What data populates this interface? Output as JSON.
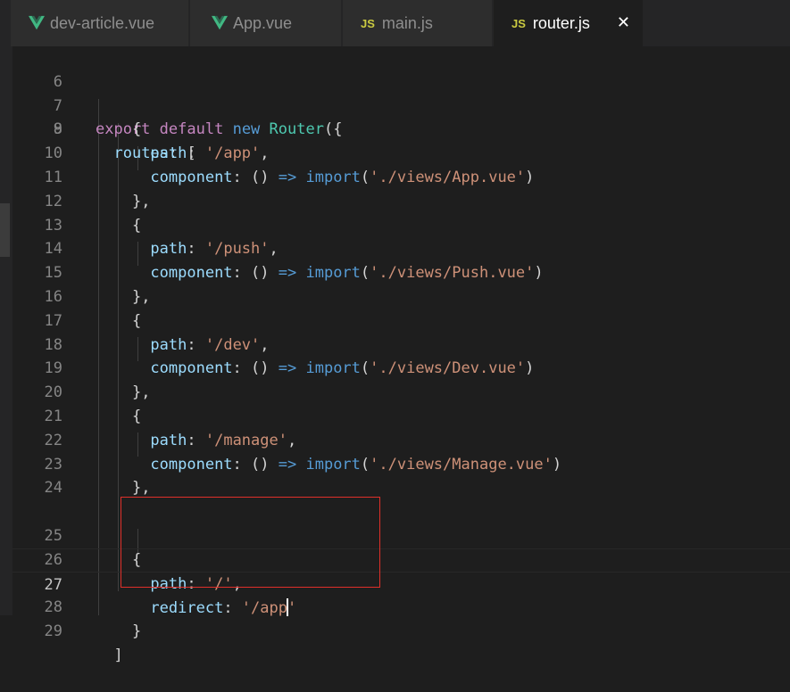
{
  "tabs": [
    {
      "label": "dev-article.vue",
      "icon": "vue-icon"
    },
    {
      "label": "App.vue",
      "icon": "vue-icon"
    },
    {
      "label": "main.js",
      "icon": "js-icon"
    },
    {
      "label": "router.js",
      "icon": "js-icon",
      "active": true
    }
  ],
  "tab_js_badge": "JS",
  "close_glyph": "✕",
  "current_line": 27,
  "lines": [
    {
      "n": "6"
    },
    {
      "n": "7"
    },
    {
      "n": "8"
    },
    {
      "n": "9"
    },
    {
      "n": "10"
    },
    {
      "n": "11"
    },
    {
      "n": "12"
    },
    {
      "n": "13"
    },
    {
      "n": "14"
    },
    {
      "n": "15"
    },
    {
      "n": "16"
    },
    {
      "n": "17"
    },
    {
      "n": "18"
    },
    {
      "n": "19"
    },
    {
      "n": "20"
    },
    {
      "n": "21"
    },
    {
      "n": "22"
    },
    {
      "n": "23"
    },
    {
      "n": "24"
    },
    {
      "n": "25"
    },
    {
      "n": "26"
    },
    {
      "n": "27"
    },
    {
      "n": "28"
    },
    {
      "n": "29"
    }
  ],
  "code": {
    "l7": {
      "export": "export",
      "default": "default",
      "new": "new",
      "Router": "Router",
      "open": "({"
    },
    "l8": {
      "key": "routes",
      "rest": ": ["
    },
    "brace_open": "{",
    "brace_close_comma": "},",
    "brace_close": "}",
    "bracket_close": "]",
    "path_key": "path",
    "component_key": "component",
    "redirect_key": "redirect",
    "colon": ": ",
    "comma": ",",
    "arrow_paren": "() ",
    "arrow": "=>",
    "import_kw": "import",
    "open_paren": "(",
    "close_paren": ")",
    "routes": [
      {
        "path": "'/app'",
        "import": "'./views/App.vue'"
      },
      {
        "path": "'/push'",
        "import": "'./views/Push.vue'"
      },
      {
        "path": "'/dev'",
        "import": "'./views/Dev.vue'"
      },
      {
        "path": "'/manage'",
        "import": "'./views/Manage.vue'"
      }
    ],
    "root_path": "'/'",
    "redirect_before_cursor": "'/app",
    "redirect_after_cursor": "'"
  },
  "colors": {
    "editor_bg": "#1e1e1e",
    "keyword": "#c586c0",
    "storage": "#569cd6",
    "class": "#4ec9b0",
    "property": "#9cdcfe",
    "string": "#ce9178",
    "annotation_box": "#e0302a"
  }
}
